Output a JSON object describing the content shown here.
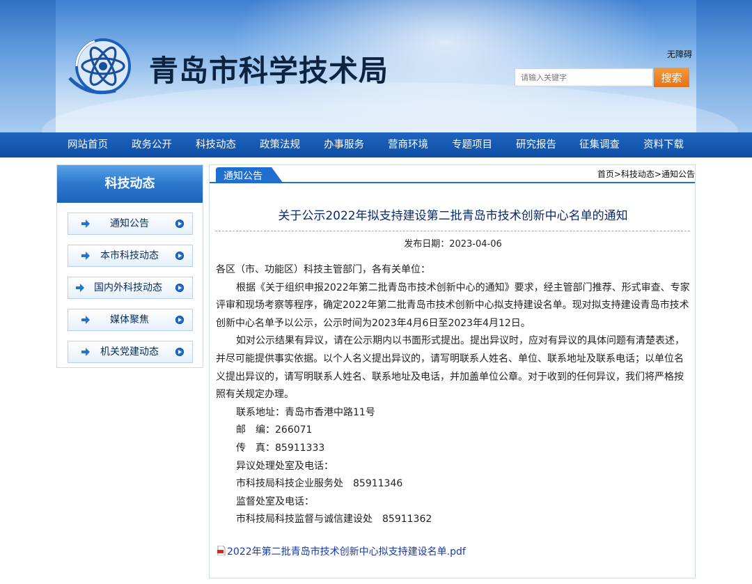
{
  "header": {
    "site_title": "青岛市科学技术局",
    "accessibility_label": "无障碍",
    "search_placeholder": "请输入关键字",
    "search_button": "搜索"
  },
  "nav": {
    "items": [
      "网站首页",
      "政务公开",
      "科技动态",
      "政策法规",
      "办事服务",
      "营商环境",
      "专题项目",
      "研究报告",
      "征集调查",
      "资料下载"
    ]
  },
  "sidebar": {
    "title": "科技动态",
    "items": [
      "通知公告",
      "本市科技动态",
      "国内外科技动态",
      "媒体聚焦",
      "机关党建动态"
    ]
  },
  "article": {
    "section_tab": "通知公告",
    "breadcrumb": "首页>科技动态>通知公告",
    "title": "关于公示2022年拟支持建设第二批青岛市技术创新中心名单的通知",
    "publish_date": "发布日期：2023-04-06",
    "greeting": "各区（市、功能区）科技主管部门，各有关单位：",
    "paragraph1": "根据《关于组织申报2022年第二批青岛市技术创新中心的通知》要求，经主管部门推荐、形式审查、专家评审和现场考察等程序，确定2022年第二批青岛市技术创新中心拟支持建设名单。现对拟支持建设青岛市技术创新中心名单予以公示，公示时间为2023年4月6日至2023年4月12日。",
    "paragraph2": "如对公示结果有异议，请在公示期内以书面形式提出。提出异议时，应对有异议的具体问题有清楚表述，并尽可能提供事实依据。以个人名义提出异议的，请写明联系人姓名、单位、联系地址及联系电话；以单位名义提出异议的，请写明联系人姓名、联系地址及电话，并加盖单位公章。对于收到的任何异议，我们将严格按照有关规定办理。",
    "contact_lines": [
      "联系地址：青岛市香港中路11号",
      "邮　编：266071",
      "传　真：85911333",
      "异议处理处室及电话：",
      "市科技局科技企业服务处　85911346",
      "监督处室及电话：",
      "市科技局科技监督与诚信建设处　85911362"
    ],
    "attachment": "2022年第二批青岛市技术创新中心拟支持建设名单.pdf"
  },
  "colors": {
    "nav_bg": "#1a5bb4",
    "accent_blue": "#1f6fd0",
    "search_button": "#ec8526",
    "title_text": "#0a2a6a"
  },
  "icons": [
    "atom-logo-icon",
    "arrow-right-icon",
    "circle-play-icon",
    "pdf-file-icon"
  ]
}
